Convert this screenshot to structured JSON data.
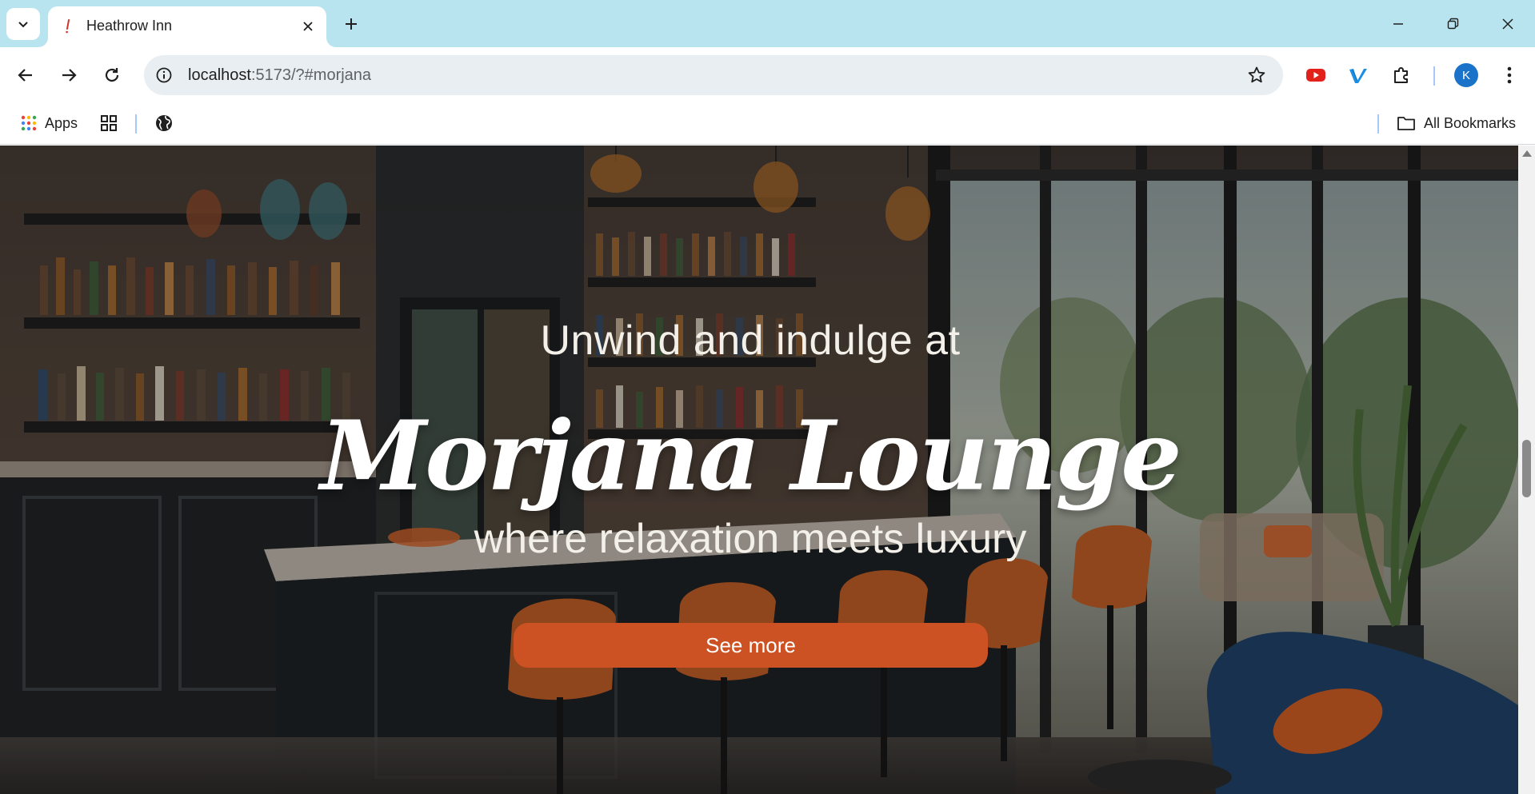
{
  "browser": {
    "tab_title": "Heathrow Inn",
    "url_host": "localhost",
    "url_path": ":5173/?#morjana",
    "profile_initial": "K",
    "bookmarks": {
      "apps_label": "Apps",
      "all_bookmarks_label": "All Bookmarks"
    },
    "icons": {
      "tab_search": "chevron-down-icon",
      "favicon": "exclamation-icon",
      "close": "close-icon",
      "new_tab": "plus-icon",
      "back": "arrow-left-icon",
      "forward": "arrow-right-icon",
      "reload": "reload-icon",
      "site_info": "info-icon",
      "bookmark_star": "star-icon",
      "extensions": [
        "youtube-icon",
        "vimeo-icon",
        "puzzle-icon"
      ],
      "menu": "kebab-menu-icon"
    },
    "colors": {
      "titlebar": "#b8e4f0",
      "omnibox": "#e9eef2",
      "avatar": "#1a73c8"
    }
  },
  "hero": {
    "pre_title": "Unwind and indulge at",
    "title": "Morjana Lounge",
    "subtitle": "where relaxation meets luxury",
    "cta_label": "See more",
    "colors": {
      "cta": "#cc5224",
      "text": "#ffffff"
    }
  }
}
